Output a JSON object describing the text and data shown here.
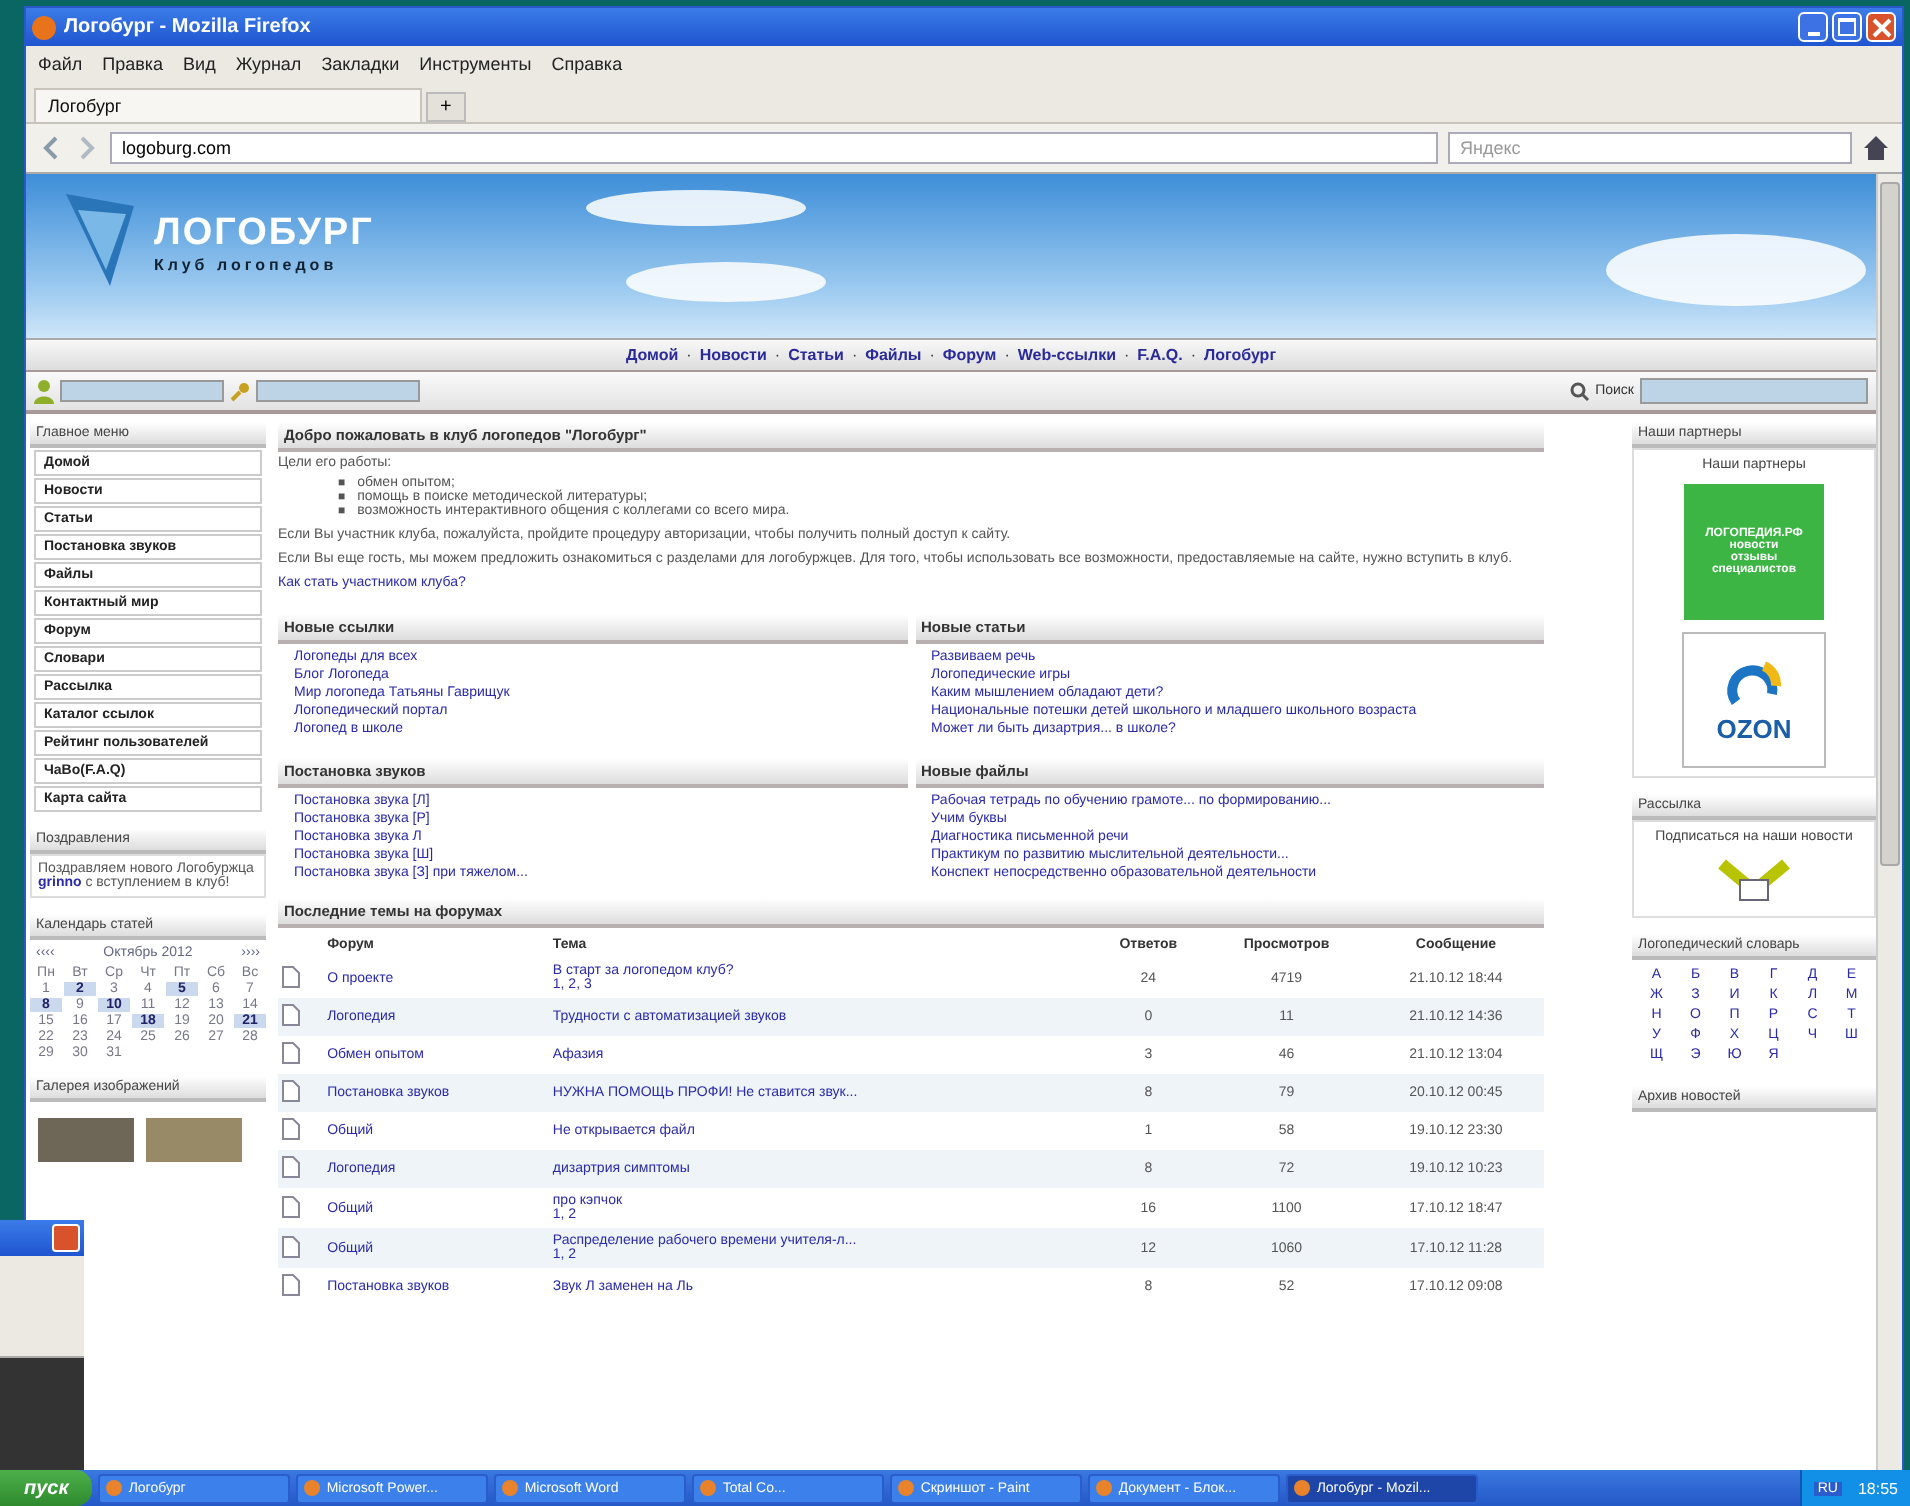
{
  "window": {
    "title": "Логобург - Mozilla Firefox"
  },
  "menu": [
    "Файл",
    "Правка",
    "Вид",
    "Журнал",
    "Закладки",
    "Инструменты",
    "Справка"
  ],
  "tabs": [
    {
      "label": "Логобург",
      "selected": true
    }
  ],
  "new_tab": "+",
  "address": {
    "value": "logoburg.com"
  },
  "browser_search": {
    "placeholder": "Яндекс"
  },
  "site": {
    "logo": "ЛОГОБУРГ",
    "tagline": "Клуб логопедов",
    "nav": [
      "Домой",
      "Новости",
      "Статьи",
      "Файлы",
      "Форум",
      "Web-ссылки",
      "F.A.Q.",
      "Логобург"
    ],
    "nav_separator": "·",
    "search_label": "Поиск"
  },
  "left": {
    "menu_title": "Главное меню",
    "menu": [
      "Домой",
      "Новости",
      "Статьи",
      "Постановка звуков",
      "Файлы",
      "Контактный мир",
      "Форум",
      "Словари",
      "Рассылка",
      "Каталог ссылок",
      "Рейтинг пользователей",
      "ЧаВо(F.A.Q)",
      "Карта сайта"
    ],
    "greet_title": "Поздравления",
    "greet_before": "Поздравляем нового Логобуржца",
    "greet_user": "grinno",
    "greet_after": "с вступлением в клуб!",
    "calendar_title": "Календарь статей",
    "calendar_prev": "‹‹‹‹",
    "calendar_month": "Октябрь 2012",
    "calendar_next": "››››",
    "weekdays": [
      "Пн",
      "Вт",
      "Ср",
      "Чт",
      "Пт",
      "Сб",
      "Вс"
    ],
    "days": [
      {
        "label": "1",
        "linked": false
      },
      {
        "label": "2",
        "linked": true
      },
      {
        "label": "3",
        "linked": false
      },
      {
        "label": "4",
        "linked": false
      },
      {
        "label": "5",
        "linked": true
      },
      {
        "label": "6",
        "linked": false
      },
      {
        "label": "7",
        "linked": false
      },
      {
        "label": "8",
        "linked": true
      },
      {
        "label": "9",
        "linked": false
      },
      {
        "label": "10",
        "linked": true
      },
      {
        "label": "11",
        "linked": false
      },
      {
        "label": "12",
        "linked": false
      },
      {
        "label": "13",
        "linked": false
      },
      {
        "label": "14",
        "linked": false
      },
      {
        "label": "15",
        "linked": false
      },
      {
        "label": "16",
        "linked": false
      },
      {
        "label": "17",
        "linked": false
      },
      {
        "label": "18",
        "linked": true
      },
      {
        "label": "19",
        "linked": false
      },
      {
        "label": "20",
        "linked": false
      },
      {
        "label": "21",
        "linked": true
      },
      {
        "label": "22",
        "linked": false
      },
      {
        "label": "23",
        "linked": false
      },
      {
        "label": "24",
        "linked": false
      },
      {
        "label": "25",
        "linked": false
      },
      {
        "label": "26",
        "linked": false
      },
      {
        "label": "27",
        "linked": false
      },
      {
        "label": "28",
        "linked": false
      },
      {
        "label": "29",
        "linked": false
      },
      {
        "label": "30",
        "linked": false
      },
      {
        "label": "31",
        "linked": false
      }
    ],
    "gallery_title": "Галерея изображений"
  },
  "center": {
    "welcome_title": "Добро пожаловать в клуб логопедов \"Логобург\"",
    "goals_intro": "Цели его работы:",
    "goal_marker": "■",
    "goals": [
      "обмен опытом;",
      "помощь в поиске методической литературы;",
      "возможность интерактивного общения с коллегами со всего мира."
    ],
    "para_member": "Если Вы участник клуба, пожалуйста, пройдите процедуру авторизации, чтобы получить полный доступ к сайту.",
    "para_guest": "Если Вы еще гость, мы можем предложить ознакомиться с разделами для логобуржцев. Для того, чтобы использовать все возможности, предоставляемые на сайте, нужно вступить в клуб.",
    "join_link": "Как стать участником клуба?",
    "blocks": [
      {
        "title": "Новые ссылки",
        "items": [
          "Логопеды для всех",
          "Блог Логопеда",
          "Мир логопеда Татьяны Гаврищук",
          "Логопедический портал",
          "Логопед в школе"
        ]
      },
      {
        "title": "Новые статьи",
        "items": [
          "Развиваем речь",
          "Логопедические игры",
          "Каким мышлением обладают дети?",
          "Национальные потешки детей школьного и младшего школьного возраста",
          "Может ли быть дизартрия... в школе?"
        ]
      },
      {
        "title": "Постановка звуков",
        "items": [
          "Постановка звука [Л]",
          "Постановка звука [Р]",
          "Постановка звука Л",
          "Постановка звука [Ш]",
          "Постановка звука [З] при тяжелом..."
        ]
      },
      {
        "title": "Новые файлы",
        "items": [
          "Рабочая тетрадь по обучению грамоте... по формированию...",
          "Учим буквы",
          "Диагностика письменной речи",
          "Практикум по развитию мыслительной деятельности...",
          "Конспект непосредственно образовательной деятельности"
        ]
      }
    ],
    "forum_title": "Последние темы на форумах",
    "forum_columns": [
      "Форум",
      "Тема",
      "Ответов",
      "Просмотров",
      "Сообщение"
    ],
    "forum_rows": [
      {
        "forum": "О проекте",
        "topic": "В старт за логопедом клуб?",
        "pages": "1, 2, 3",
        "replies": "24",
        "views": "4719",
        "date": "21.10.12 18:44"
      },
      {
        "forum": "Логопедия",
        "topic": "Трудности с автоматизацией звуков",
        "replies": "0",
        "views": "11",
        "date": "21.10.12 14:36"
      },
      {
        "forum": "Обмен опытом",
        "topic": "Афазия",
        "replies": "3",
        "views": "46",
        "date": "21.10.12 13:04"
      },
      {
        "forum": "Постановка звуков",
        "topic": "НУЖНА ПОМОЩЬ ПРОФИ! Не ставится звук...",
        "replies": "8",
        "views": "79",
        "date": "20.10.12 00:45"
      },
      {
        "forum": "Общий",
        "topic": "Не открывается файл",
        "replies": "1",
        "views": "58",
        "date": "19.10.12 23:30"
      },
      {
        "forum": "Логопедия",
        "topic": "дизартрия симптомы",
        "replies": "8",
        "views": "72",
        "date": "19.10.12 10:23"
      },
      {
        "forum": "Общий",
        "topic": "про кэпчок",
        "pages": "1, 2",
        "replies": "16",
        "views": "1100",
        "date": "17.10.12 18:47"
      },
      {
        "forum": "Общий",
        "topic": "Распределение рабочего времени учителя-л...",
        "pages": "1, 2",
        "replies": "12",
        "views": "1060",
        "date": "17.10.12 11:28"
      },
      {
        "forum": "Постановка звуков",
        "topic": "Звук Л заменен на Ль",
        "replies": "8",
        "views": "52",
        "date": "17.10.12 09:08"
      }
    ]
  },
  "right": {
    "partners_title": "Наши партнеры",
    "partners_sub": "Наши партнеры",
    "partner_banner": [
      "ЛОГОПЕДИЯ.РФ",
      "новости",
      "отзывы",
      "специалистов"
    ],
    "ozon": "OZON",
    "mail_title": "Рассылка",
    "mail_text": "Подписаться на наши новости",
    "dict_title": "Логопедический словарь",
    "letters": [
      "А",
      "Б",
      "В",
      "Г",
      "Д",
      "Е",
      "Ж",
      "З",
      "И",
      "К",
      "Л",
      "М",
      "Н",
      "О",
      "П",
      "Р",
      "С",
      "Т",
      "У",
      "Ф",
      "Х",
      "Ц",
      "Ч",
      "Ш",
      "Щ",
      "Э",
      "Ю",
      "Я"
    ],
    "archive_title": "Архив новостей"
  },
  "taskbar": {
    "start": "пуск",
    "items": [
      {
        "label": "Логобург",
        "selected": false
      },
      {
        "label": "Microsoft Power...",
        "selected": false
      },
      {
        "label": "Microsoft Word",
        "selected": false
      },
      {
        "label": "Total Co...",
        "selected": false
      },
      {
        "label": "Скриншот - Paint",
        "selected": false
      },
      {
        "label": "Документ - Блок...",
        "selected": false
      },
      {
        "label": "Логобург - Mozil...",
        "selected": true
      }
    ],
    "lang": "RU",
    "clock": "18:55"
  }
}
